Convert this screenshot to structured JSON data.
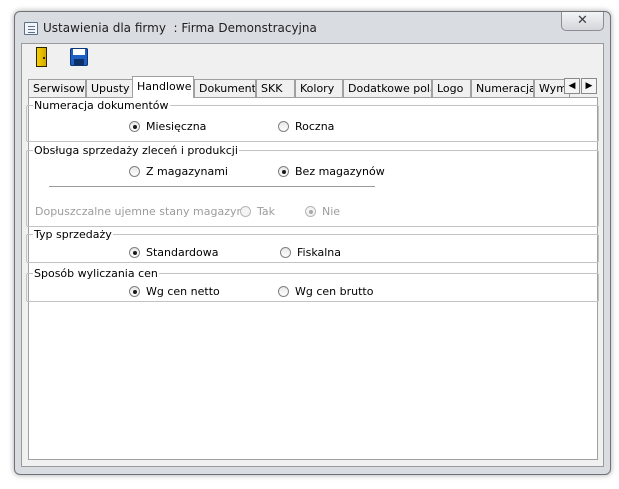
{
  "window": {
    "title": "Ustawienia dla firmy  : Firma Demonstracyjna",
    "close_glyph": "✕"
  },
  "toolbar": {
    "exit_icon": "door-exit-icon",
    "save_icon": "floppy-disk-icon"
  },
  "tabs": {
    "items": [
      {
        "label": "Serwisowe"
      },
      {
        "label": "Upusty"
      },
      {
        "label": "Handlowe"
      },
      {
        "label": "Dokumenty"
      },
      {
        "label": "SKK"
      },
      {
        "label": "Kolory"
      },
      {
        "label": "Dodatkowe pola"
      },
      {
        "label": "Logo"
      },
      {
        "label": "Numeracja"
      },
      {
        "label": "Wymiana"
      }
    ],
    "active": "Handlowe",
    "scroll_left": "◀",
    "scroll_right": "▶"
  },
  "groups": {
    "numeracja": {
      "legend": "Numeracja dokumentów",
      "option1": "Miesięczna",
      "option2": "Roczna",
      "selected": "Miesięczna"
    },
    "obsluga": {
      "legend": "Obsługa sprzedaży zleceń i produkcji",
      "option1": "Z magazynami",
      "option2": "Bez magazynów",
      "selected": "Bez magazynów",
      "stock_label": "Dopuszczalne ujemne stany magazynu",
      "stock_yes": "Tak",
      "stock_no": "Nie",
      "stock_selected": "Nie"
    },
    "typ": {
      "legend": "Typ sprzedaży",
      "option1": "Standardowa",
      "option2": "Fiskalna",
      "selected": "Standardowa"
    },
    "ceny": {
      "legend": "Sposób wyliczania cen",
      "option1": "Wg cen netto",
      "option2": "Wg cen brutto",
      "selected": "Wg cen netto"
    }
  }
}
